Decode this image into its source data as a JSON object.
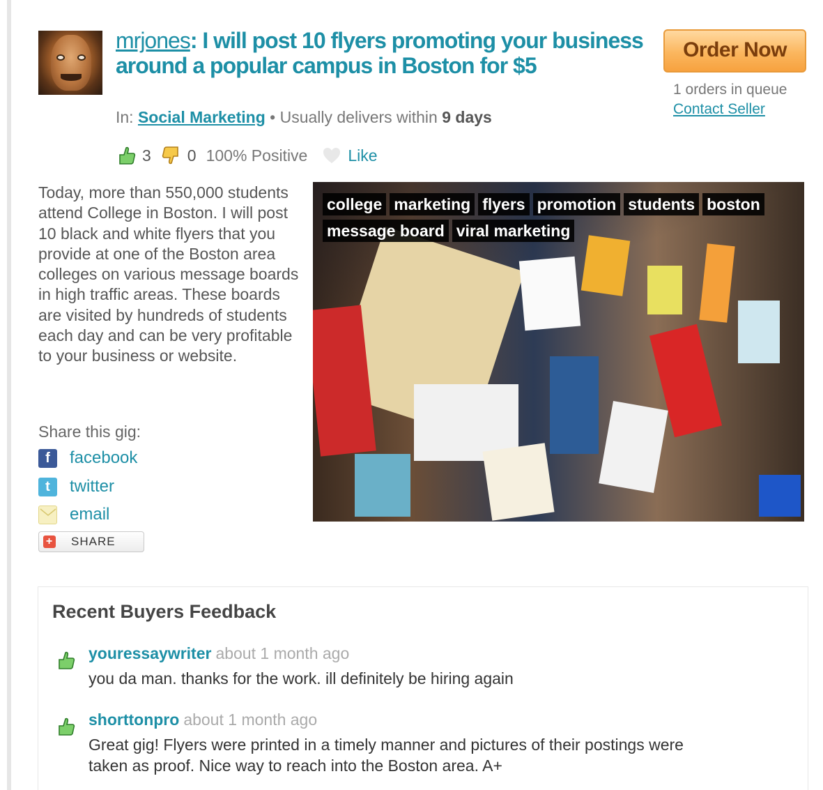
{
  "gig": {
    "username": "mrjones",
    "title_rest": ": I will post 10 flyers promoting your business around a popular campus in Boston for $5",
    "in_label": "In:",
    "category": "Social Marketing",
    "delivers_prefix": " • Usually delivers within ",
    "delivery_days": "9 days"
  },
  "order": {
    "button_label": "Order Now",
    "queue_text": "1 orders in queue",
    "contact_label": "Contact Seller"
  },
  "ratings": {
    "positive_count": "3",
    "negative_count": "0",
    "percent_positive": "100% Positive",
    "like_label": "Like"
  },
  "description": "Today, more than 550,000 students attend College in Boston. I will post 10 black and white flyers that you provide at one of the Boston area colleges on various message boards in high traffic areas. These boards are visited by hundreds of students each day and can be very profitable to your business or website.",
  "share": {
    "label": "Share this gig:",
    "items": [
      {
        "label": "facebook",
        "icon": "facebook-icon"
      },
      {
        "label": "twitter",
        "icon": "twitter-icon"
      },
      {
        "label": "email",
        "icon": "email-icon"
      }
    ],
    "share_button_label": "SHARE"
  },
  "tags": [
    "college",
    "marketing",
    "flyers",
    "promotion",
    "students",
    "boston",
    "message board",
    "viral marketing"
  ],
  "feedback": {
    "title": "Recent Buyers Feedback",
    "items": [
      {
        "user": "youressaywriter",
        "time": "about 1 month ago",
        "text": "you da man. thanks for the work. ill definitely be hiring again"
      },
      {
        "user": "shorttonpro",
        "time": "about 1 month ago",
        "text": "Great gig! Flyers were printed in a timely manner and pictures of their postings were taken as proof. Nice way to reach into the Boston area. A+"
      }
    ]
  },
  "colors": {
    "link": "#1d8fa6",
    "order_button": "#fbb65e",
    "thumb_green": "#5cb85c"
  }
}
